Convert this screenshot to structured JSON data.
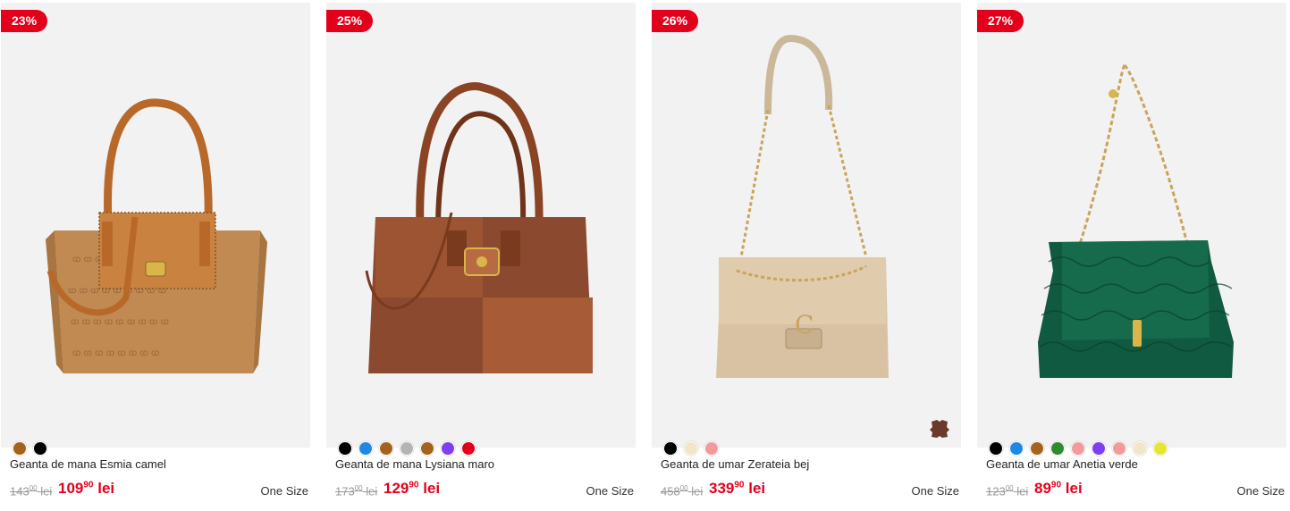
{
  "products": [
    {
      "discount": "23%",
      "title": "Geanta de mana Esmia camel",
      "old_price_int": "143",
      "old_price_dec": "00",
      "old_currency": "lei",
      "price_int": "109",
      "price_dec": "90",
      "currency": "lei",
      "size": "One Size",
      "swatches": [
        "#a5621d",
        "#000000"
      ],
      "image_icon": "handbag-camel-image"
    },
    {
      "discount": "25%",
      "title": "Geanta de mana Lysiana maro",
      "old_price_int": "173",
      "old_price_dec": "00",
      "old_currency": "lei",
      "price_int": "129",
      "price_dec": "90",
      "currency": "lei",
      "size": "One Size",
      "swatches": [
        "#000000",
        "#1e88e5",
        "#a5621d",
        "#b4b4b4",
        "#a5621d",
        "#7e3ff2",
        "#e3001b"
      ],
      "image_icon": "handbag-brown-image"
    },
    {
      "discount": "26%",
      "title": "Geanta de umar Zerateia bej",
      "old_price_int": "458",
      "old_price_dec": "00",
      "old_currency": "lei",
      "price_int": "339",
      "price_dec": "90",
      "currency": "lei",
      "size": "One Size",
      "swatches": [
        "#000000",
        "#f3e5c8",
        "#f39a9a"
      ],
      "image_icon": "shoulder-bag-beige-image",
      "badge_icon": "leather-icon"
    },
    {
      "discount": "27%",
      "title": "Geanta de umar Anetia verde",
      "old_price_int": "123",
      "old_price_dec": "00",
      "old_currency": "lei",
      "price_int": "89",
      "price_dec": "90",
      "currency": "lei",
      "size": "One Size",
      "swatches": [
        "#000000",
        "#1e88e5",
        "#a5621d",
        "#2e8b2e",
        "#f39a9a",
        "#7e3ff2",
        "#f39a9a",
        "#f3e5c8",
        "#e6e632"
      ],
      "image_icon": "shoulder-bag-green-image"
    }
  ]
}
